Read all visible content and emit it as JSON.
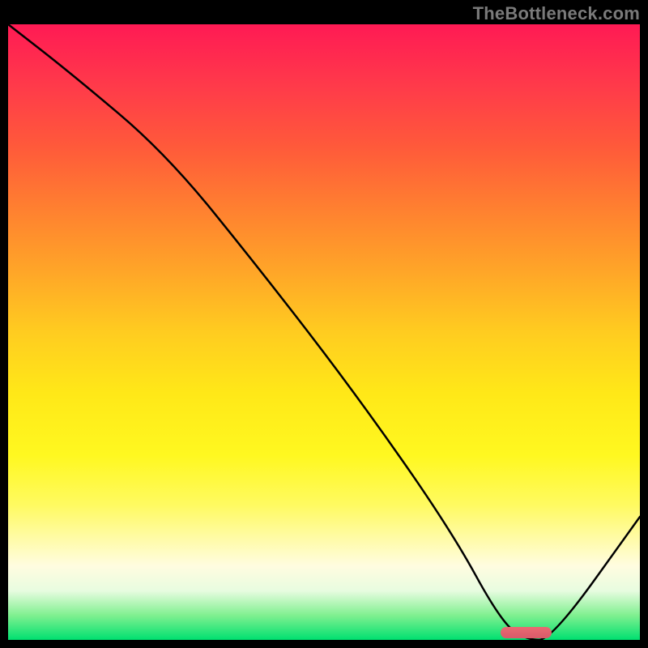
{
  "watermark": "TheBottleneck.com",
  "chart_data": {
    "type": "line",
    "title": "",
    "xlabel": "",
    "ylabel": "",
    "xlim": [
      0,
      100
    ],
    "ylim": [
      0,
      100
    ],
    "series": [
      {
        "name": "curve",
        "x": [
          0,
          10,
          25,
          40,
          55,
          70,
          78,
          82,
          86,
          100
        ],
        "y": [
          100,
          92,
          79,
          60,
          40,
          18,
          3,
          0,
          0,
          20
        ]
      }
    ],
    "marker": {
      "x_start": 78,
      "x_end": 86,
      "y": 0
    },
    "gradient_stops": [
      {
        "pos": 0,
        "color": "#ff1a54"
      },
      {
        "pos": 50,
        "color": "#ffcc20"
      },
      {
        "pos": 88,
        "color": "#fffce0"
      },
      {
        "pos": 100,
        "color": "#00e070"
      }
    ]
  }
}
